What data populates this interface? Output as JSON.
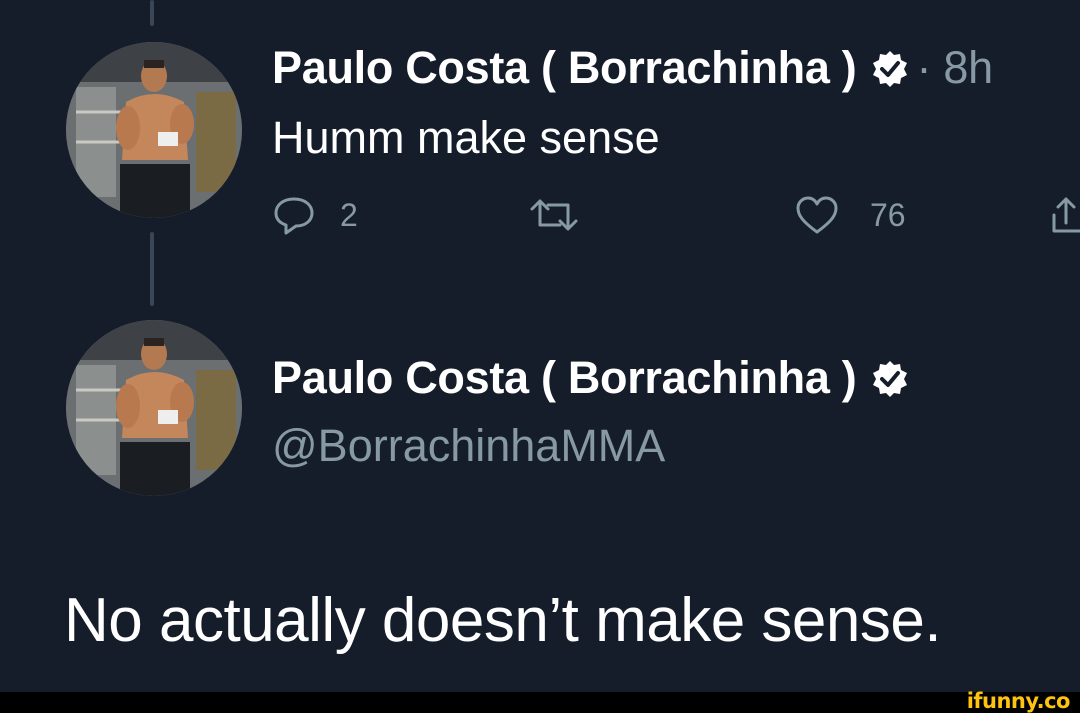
{
  "colors": {
    "background": "#151d2b",
    "text_primary": "#ffffff",
    "text_secondary": "#8899a6",
    "thread_line": "#3a4556",
    "watermark": "#ffc20e"
  },
  "reply_tweet": {
    "author_name": "Paulo Costa ( Borrachinha )",
    "verified": true,
    "time_prefix": "·",
    "time": "8h",
    "text": "Humm make sense",
    "actions": {
      "reply_count": "2",
      "retweet_count": "",
      "like_count": "76"
    },
    "icons": [
      "reply-icon",
      "retweet-icon",
      "like-icon",
      "share-icon"
    ]
  },
  "profile_card": {
    "author_name": "Paulo Costa ( Borrachinha )",
    "verified": true,
    "handle": "@BorrachinhaMMA"
  },
  "caption": "No actually doesn’t make sense.",
  "watermark": "ifunny.co"
}
